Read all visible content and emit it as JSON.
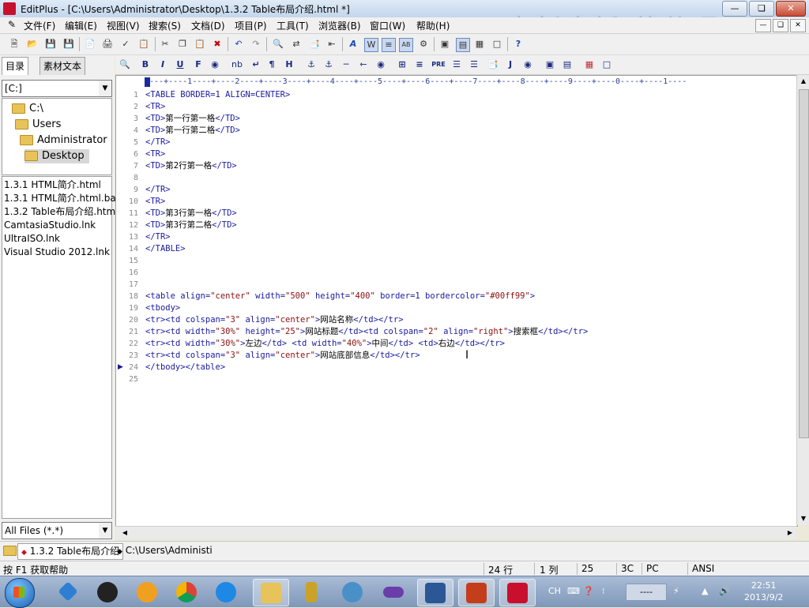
{
  "window": {
    "title": "EditPlus - [C:\\Users\\Administrator\\Desktop\\1.3.2 Table布局介绍.html *]"
  },
  "watermark": "中新金桥  软件通",
  "menu": [
    "文件(F)",
    "编辑(E)",
    "视图(V)",
    "搜索(S)",
    "文档(D)",
    "项目(P)",
    "工具(T)",
    "浏览器(B)",
    "窗口(W)",
    "帮助(H)"
  ],
  "left_panel": {
    "tabs": [
      "目录",
      "素材文本"
    ],
    "drive": "[C:]",
    "tree": [
      "C:\\",
      "Users",
      "Administrator",
      "Desktop"
    ],
    "files": [
      "1.3.1 HTML简介.html",
      "1.3.1 HTML简介.html.ba",
      "1.3.2 Table布局介绍.htm",
      "CamtasiaStudio.lnk",
      "UltraISO.lnk",
      "Visual Studio 2012.lnk"
    ],
    "filter": "All Files (*.*)"
  },
  "html_toolbar": [
    "B",
    "I",
    "U",
    "F",
    "nb",
    "¶",
    "H",
    "PRE",
    "J"
  ],
  "ruler": "----+----1----+----2----+----3----+----4----+----5----+----6----+----7----+----8----+----9----+----0----+----1----",
  "code": [
    {
      "n": "1",
      "t": "<TABLE BORDER=1 ALIGN=CENTER>"
    },
    {
      "n": "2",
      "t": "<TR>"
    },
    {
      "n": "3",
      "t": "<TD>第一行第一格</TD>"
    },
    {
      "n": "4",
      "t": "<TD>第一行第二格</TD>"
    },
    {
      "n": "5",
      "t": "</TR>"
    },
    {
      "n": "6",
      "t": "<TR>"
    },
    {
      "n": "7",
      "t": "<TD>第2行第一格</TD>"
    },
    {
      "n": "8",
      "t": ""
    },
    {
      "n": "9",
      "t": "</TR>"
    },
    {
      "n": "10",
      "t": "<TR>"
    },
    {
      "n": "11",
      "t": "<TD>第3行第一格</TD>"
    },
    {
      "n": "12",
      "t": "<TD>第3行第二格</TD>"
    },
    {
      "n": "13",
      "t": "</TR>"
    },
    {
      "n": "14",
      "t": "</TABLE>"
    },
    {
      "n": "15",
      "t": ""
    },
    {
      "n": "16",
      "t": ""
    },
    {
      "n": "17",
      "t": ""
    },
    {
      "n": "18",
      "t": "<table align=\"center\" width=\"500\" height=\"400\" border=1 bordercolor=\"#00ff99\">"
    },
    {
      "n": "19",
      "t": "<tbody>"
    },
    {
      "n": "20",
      "t": "<tr><td colspan=\"3\" align=\"center\">网站名称</td></tr>"
    },
    {
      "n": "21",
      "t": "<tr><td width=\"30%\" height=\"25\">网站标题</td><td colspan=\"2\" align=\"right\">搜索框</td></tr>"
    },
    {
      "n": "22",
      "t": "<tr><td width=\"30%\">左边</td> <td width=\"40%\">中间</td> <td>右边</td></tr>"
    },
    {
      "n": "23",
      "t": "<tr><td colspan=\"3\" align=\"center\">网站底部信息</td></tr>"
    },
    {
      "n": "24",
      "t": "</tbody></table>"
    },
    {
      "n": "25",
      "t": ""
    }
  ],
  "doc_tabs": [
    "1.3.2 Table布局介绍",
    "C:\\Users\\Administi"
  ],
  "status": {
    "help": "按 F1 获取帮助",
    "line": "24 行",
    "col": "1 列",
    "num": "25",
    "code": "3C",
    "mode": "PC",
    "encoding": "ANSI"
  },
  "taskbar": {
    "tray_lang": "CH",
    "time": "22:51",
    "date": "2013/9/2",
    "volume_text": "----"
  },
  "colors": {
    "tag": "#1a1aa0",
    "text": "#000000",
    "string": "#8a1010",
    "accent": "#c8102e"
  }
}
